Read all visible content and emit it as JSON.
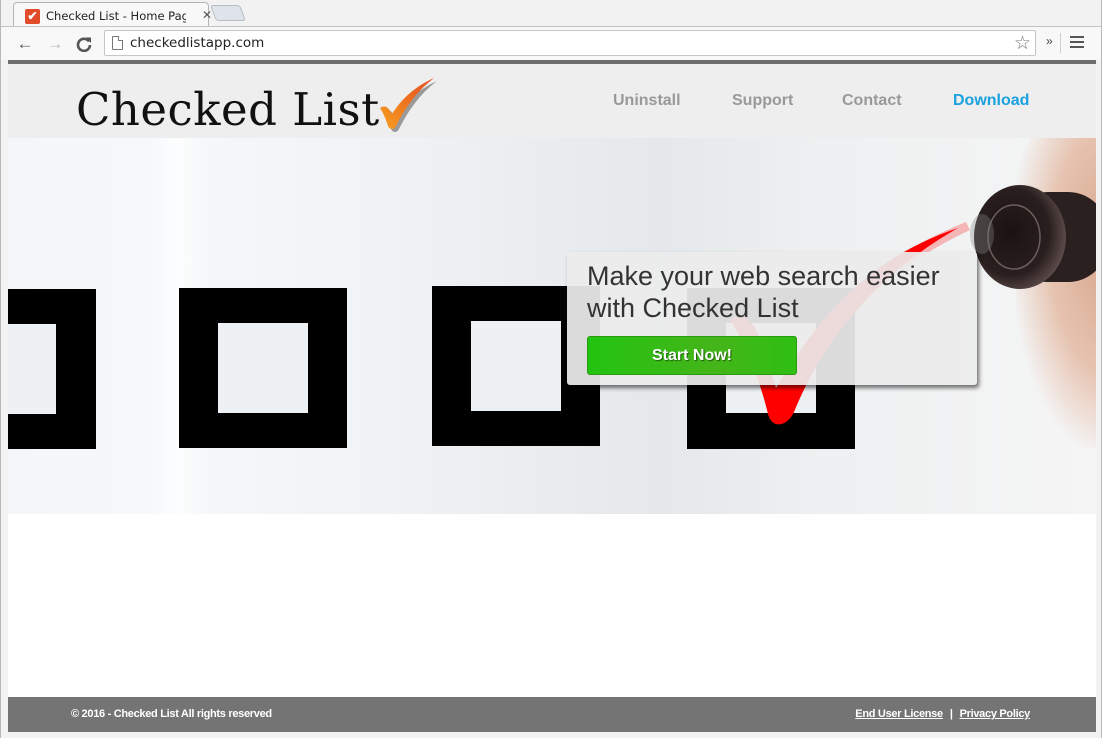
{
  "browser": {
    "tab": {
      "title": "Checked List - Home Page",
      "favicon_glyph": "✔",
      "favicon_color": "#e24b2a",
      "close_glyph": "✕"
    },
    "toolbar": {
      "back_glyph": "←",
      "forward_glyph": "→",
      "reload_glyph": "C",
      "url": "checkedlistapp.com",
      "bookmark_glyph": "☆",
      "extensions_more_glyph": "»"
    }
  },
  "site": {
    "logo_text": "Checked List",
    "logo_check_color": "#f07a1a",
    "nav": [
      {
        "label": "Uninstall",
        "active": false
      },
      {
        "label": "Support",
        "active": false
      },
      {
        "label": "Contact",
        "active": false
      },
      {
        "label": "Download",
        "active": true
      }
    ],
    "accent_color": "#1aa1e0",
    "hero": {
      "headline": "Make your web search easier with Checked List",
      "cta_label": "Start Now!",
      "cta_color": "#2fbf12"
    },
    "footer": {
      "copyright": "© 2016 - Checked List All rights reserved",
      "links": [
        {
          "label": "End User License"
        },
        {
          "label": "Privacy Policy"
        }
      ],
      "separator": "|"
    }
  }
}
